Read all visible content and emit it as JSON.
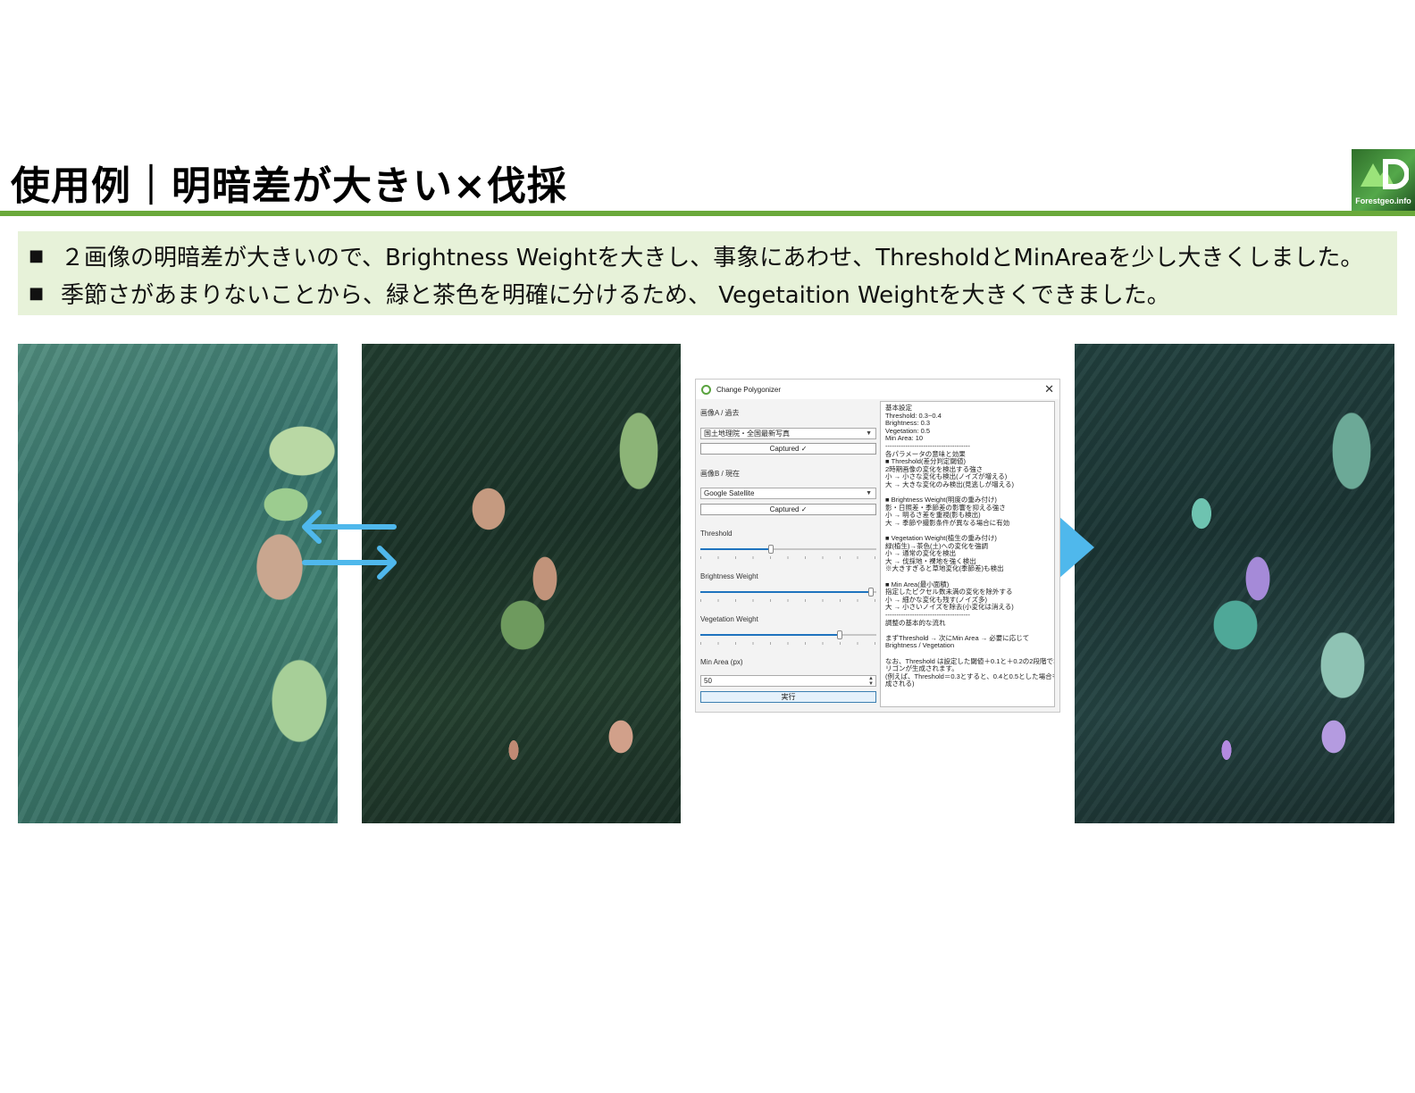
{
  "slide": {
    "title": "使用例｜明暗差が大きい×伐採",
    "logo_text": "Forestgeo.info",
    "bullets": [
      "２画像の明暗差が大きいので、Brightness Weightを大きし、事象にあわせ、ThresholdとMinAreaを少し大きくしました。",
      "季節さがあまりないことから、緑と茶色を明確に分けるため、 Vegetaition Weightを大きくできました。"
    ],
    "bullet_marker": "■"
  },
  "colors": {
    "title_rule": "#6aa93a",
    "bullet_bg": "#e7f2d9",
    "arrow": "#4fb8ec",
    "slider_fill": "#1e73be"
  },
  "dialog": {
    "title": "Change Polygonizer",
    "icon": "qgis-icon",
    "close_glyph": "✕",
    "image_a_label": "画像A / 過去",
    "image_a_value": "国土地理院・全国最新写真",
    "image_a_button": "Captured ✓",
    "image_b_label": "画像B / 現在",
    "image_b_value": "Google Satellite",
    "image_b_button": "Captured ✓",
    "threshold_label": "Threshold",
    "threshold_level": 0.4,
    "brightness_label": "Brightness Weight",
    "brightness_level": 0.97,
    "vegetation_label": "Vegetation Weight",
    "vegetation_level": 0.79,
    "min_area_label": "Min Area (px)",
    "min_area_value": "50",
    "run_button": "実行",
    "help_text": "基本設定\nThreshold: 0.3~0.4\nBrightness: 0.3\nVegetation: 0.5\nMin Area: 10\n--------------------------------------\n各パラメータの意味と効果\n■ Threshold(差分判定閾値)\n2時期画像の変化を検出する強さ\n小 → 小さな変化も検出(ノイズが増える)\n大 → 大きな変化のみ検出(見逃しが増える)\n\n■ Brightness Weight(明度の重み付け)\n影・日照差・季節差の影響を抑える強さ\n小 → 明るさ差を重視(影も検出)\n大 → 季節や撮影条件が異なる場合に有効\n\n■ Vegetation Weight(植生の重み付け)\n緑(植生)→茶色(土)への変化を強調\n小 → 通常の変化を検出\n大 → 伐採地・裸地を強く検出\n※大きすぎると草地変化(季節差)も検出\n\n■ Min Area(最小面積)\n指定したピクセル数未満の変化を除外する\n小 → 細かな変化も残す(ノイズ多)\n大 → 小さいノイズを除去(小変化は消える)\n--------------------------------------\n調整の基本的な流れ\n\nまずThreshold → 次にMin Area → 必要に応じて\nBrightness / Vegetation\n\nなお、Threshold は設定した閾値＋0.1と＋0.2の2段階でポ\nリゴンが生成されます。\n(例えば、Threshold＝0.3とすると、0.4と0.5とした場合も生\n成される)"
  }
}
